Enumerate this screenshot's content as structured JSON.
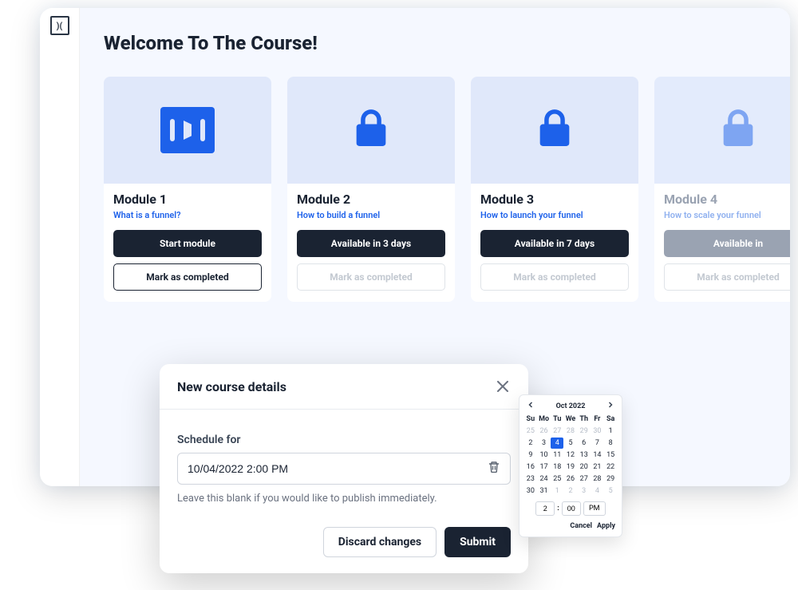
{
  "page": {
    "title": "Welcome To The Course!"
  },
  "modules": [
    {
      "title": "Module 1",
      "subtitle": "What is a funnel?",
      "icon": "funnel",
      "primary_label": "Start module",
      "primary_disabled": false,
      "secondary_label": "Mark as completed",
      "secondary_disabled": false,
      "faded": false
    },
    {
      "title": "Module 2",
      "subtitle": "How to build a funnel",
      "icon": "lock",
      "primary_label": "Available in 3 days",
      "primary_disabled": false,
      "secondary_label": "Mark as completed",
      "secondary_disabled": true,
      "faded": false
    },
    {
      "title": "Module 3",
      "subtitle": "How to launch your funnel",
      "icon": "lock",
      "primary_label": "Available in 7 days",
      "primary_disabled": false,
      "secondary_label": "Mark as completed",
      "secondary_disabled": true,
      "faded": false
    },
    {
      "title": "Module 4",
      "subtitle": "How to scale your funnel",
      "icon": "lock",
      "primary_label": "Available in",
      "primary_disabled": true,
      "secondary_label": "Mark as completed",
      "secondary_disabled": true,
      "faded": true
    }
  ],
  "modal": {
    "title": "New course details",
    "field_label": "Schedule for",
    "field_value": "10/04/2022 2:00 PM",
    "helper_text": "Leave this blank if you would like to publish immediately.",
    "discard_label": "Discard changes",
    "submit_label": "Submit"
  },
  "datepicker": {
    "month_label": "Oct 2022",
    "dow": [
      "Su",
      "Mo",
      "Tu",
      "We",
      "Th",
      "Fr",
      "Sa"
    ],
    "leading": [
      25,
      26,
      27,
      28,
      29,
      30,
      1
    ],
    "weeks": [
      [
        2,
        3,
        4,
        5,
        6,
        7,
        8
      ],
      [
        9,
        10,
        11,
        12,
        13,
        14,
        15
      ],
      [
        16,
        17,
        18,
        19,
        20,
        21,
        22
      ],
      [
        23,
        24,
        25,
        26,
        27,
        28,
        29
      ]
    ],
    "trailing": [
      30,
      31,
      1,
      2,
      3,
      4,
      5
    ],
    "selected_day": 4,
    "time_hour": "2",
    "time_minute": "00",
    "ampm": "PM",
    "cancel_label": "Cancel",
    "apply_label": "Apply"
  }
}
